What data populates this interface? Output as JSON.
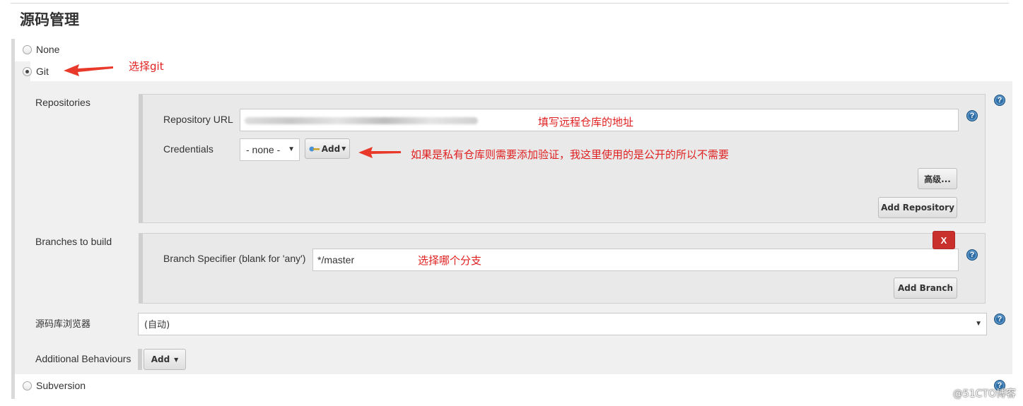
{
  "section": {
    "title": "源码管理"
  },
  "scm_options": {
    "none_label": "None",
    "git_label": "Git",
    "subversion_label": "Subversion",
    "selected": "Git"
  },
  "git": {
    "repositories_label": "Repositories",
    "repository_url_label": "Repository URL",
    "repository_url_value": "",
    "credentials_label": "Credentials",
    "credentials_selected": "- none -",
    "credentials_add_button": "Add",
    "advanced_button": "高级...",
    "add_repository_button": "Add Repository",
    "branches_label": "Branches to build",
    "branch_specifier_label": "Branch Specifier (blank for 'any')",
    "branch_specifier_value": "*/master",
    "delete_branch_button": "X",
    "add_branch_button": "Add Branch",
    "repo_browser_label": "源码库浏览器",
    "repo_browser_selected": "(自动)",
    "additional_behaviours_label": "Additional Behaviours",
    "additional_add_button": "Add"
  },
  "annotations": {
    "choose_git": "选择git",
    "fill_repo_url": "填写远程仓库的地址",
    "credentials_note": "如果是私有仓库则需要添加验证，我这里使用的是公开的所以不需要",
    "choose_branch": "选择哪个分支"
  },
  "watermark": "@51CTO博客",
  "colors": {
    "annotation_red": "#e02020",
    "help_icon_blue": "#2f6ea5",
    "delete_button_red": "#c9302c",
    "panel_gray": "#e9e9e9"
  },
  "icons": {
    "help": "help-icon",
    "key": "key-icon",
    "dropdown": "chevron-down-icon",
    "arrow": "red-arrow-icon"
  }
}
